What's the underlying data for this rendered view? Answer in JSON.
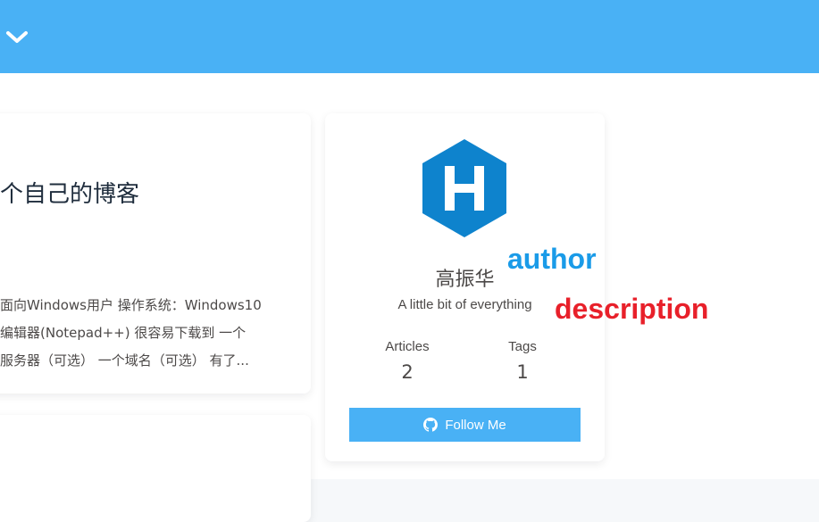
{
  "header": {
    "menu_icon": "chevron-down-icon",
    "background": "#49b1f5"
  },
  "post": {
    "title_fragment": "个自己的博客",
    "excerpt_lines": [
      "面向Windows用户 操作系统：Windows10",
      "编辑器(Notepad++) 很容易下载到 一个",
      "服务器（可选） 一个域名（可选） 有了..."
    ]
  },
  "author_card": {
    "avatar_icon": "hexo-logo-icon",
    "avatar_color": "#0e83cd",
    "name": "高振华",
    "description": "A little bit of everything",
    "stats": [
      {
        "label": "Articles",
        "value": "2"
      },
      {
        "label": "Tags",
        "value": "1"
      }
    ],
    "follow_button": {
      "label": "Follow Me",
      "icon": "github-icon"
    }
  },
  "annotations": {
    "author": "author",
    "author_color": "#1a9be8",
    "description": "description",
    "description_color": "#e8202a"
  }
}
